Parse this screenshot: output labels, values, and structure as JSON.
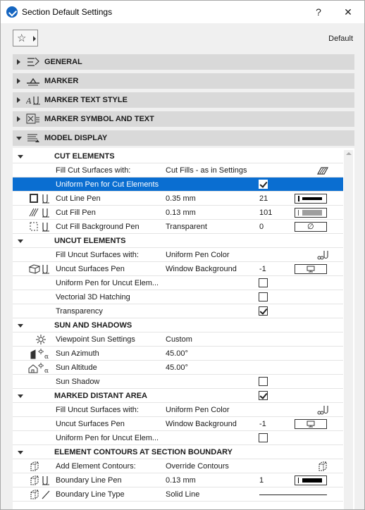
{
  "window": {
    "title": "Section Default Settings",
    "help": "?",
    "close": "✕",
    "favorites_icon": "star-icon",
    "default_label": "Default"
  },
  "panels": [
    {
      "label": "GENERAL",
      "icon": "general-icon",
      "expanded": false
    },
    {
      "label": "MARKER",
      "icon": "marker-icon",
      "expanded": false
    },
    {
      "label": "MARKER TEXT STYLE",
      "icon": "marker-text-style-icon",
      "expanded": false
    },
    {
      "label": "MARKER SYMBOL AND TEXT",
      "icon": "marker-symbol-text-icon",
      "expanded": false
    },
    {
      "label": "MODEL DISPLAY",
      "icon": "model-display-icon",
      "expanded": true
    }
  ],
  "groups": {
    "cut": {
      "label": "CUT ELEMENTS",
      "fill_cut": {
        "name": "Fill Cut Surfaces with:",
        "value": "Cut Fills - as in Settings"
      },
      "uniform_pen": {
        "name": "Uniform Pen for Cut Elements",
        "checked": true
      },
      "cut_line_pen": {
        "name": "Cut Line Pen",
        "value": "0.35 mm",
        "pen": "21"
      },
      "cut_fill_pen": {
        "name": "Cut Fill Pen",
        "value": "0.13 mm",
        "pen": "101"
      },
      "cut_fill_bg_pen": {
        "name": "Cut Fill Background Pen",
        "value": "Transparent",
        "pen": "0",
        "swatch": "∅"
      }
    },
    "uncut": {
      "label": "UNCUT ELEMENTS",
      "fill_uncut": {
        "name": "Fill Uncut Surfaces with:",
        "value": "Uniform Pen Color"
      },
      "uncut_pen": {
        "name": "Uncut Surfaces Pen",
        "value": "Window Background",
        "pen": "-1"
      },
      "uniform_uncut": {
        "name": "Uniform Pen for Uncut Elem...",
        "checked": false
      },
      "vectorial_hatching": {
        "name": "Vectorial 3D Hatching",
        "checked": false
      },
      "transparency": {
        "name": "Transparency",
        "checked": true
      }
    },
    "sun": {
      "label": "SUN AND SHADOWS",
      "viewpoint": {
        "name": "Viewpoint Sun Settings",
        "value": "Custom"
      },
      "azimuth": {
        "name": "Sun Azimuth",
        "value": "45.00°"
      },
      "altitude": {
        "name": "Sun Altitude",
        "value": "45.00°"
      },
      "shadow": {
        "name": "Sun Shadow",
        "checked": false
      }
    },
    "distant": {
      "label": "MARKED DISTANT AREA",
      "checked": true,
      "fill_uncut": {
        "name": "Fill Uncut Surfaces with:",
        "value": "Uniform Pen Color"
      },
      "uncut_pen": {
        "name": "Uncut Surfaces Pen",
        "value": "Window Background",
        "pen": "-1"
      },
      "uniform_uncut": {
        "name": "Uniform Pen for Uncut Elem...",
        "checked": false
      }
    },
    "contours": {
      "label": "ELEMENT CONTOURS AT SECTION BOUNDARY",
      "add": {
        "name": "Add Element Contours:",
        "value": "Override Contours"
      },
      "boundary_pen": {
        "name": "Boundary Line Pen",
        "value": "0.13 mm",
        "pen": "1"
      },
      "boundary_type": {
        "name": "Boundary Line Type",
        "value": "Solid Line"
      }
    }
  }
}
